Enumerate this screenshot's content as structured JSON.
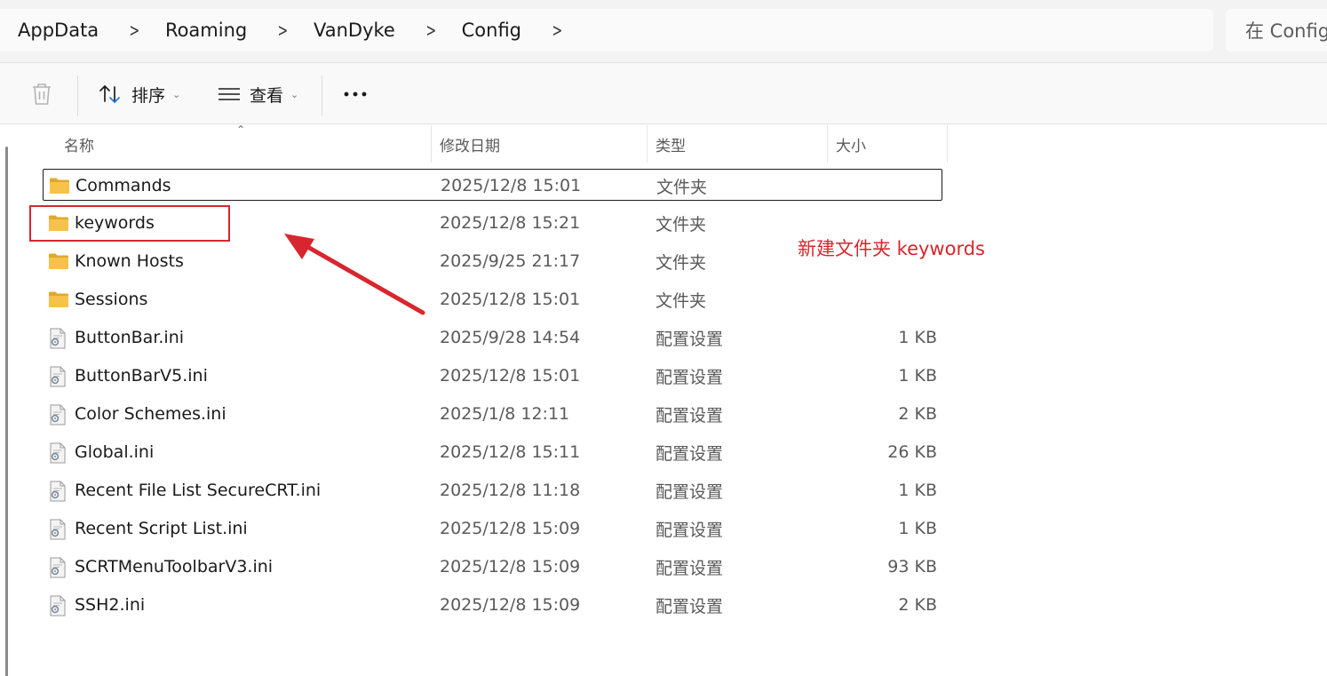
{
  "breadcrumb": [
    "AppData",
    "Roaming",
    "VanDyke",
    "Config"
  ],
  "search": {
    "placeholder": "在 Config"
  },
  "toolbar": {
    "sort_label": "排序",
    "view_label": "查看"
  },
  "columns": {
    "name": "名称",
    "modified": "修改日期",
    "type": "类型",
    "size": "大小"
  },
  "files": [
    {
      "name": "Commands",
      "modified": "2025/12/8 15:01",
      "type": "文件夹",
      "size": "",
      "icon": "folder-icon",
      "selected": true
    },
    {
      "name": "keywords",
      "modified": "2025/12/8 15:21",
      "type": "文件夹",
      "size": "",
      "icon": "folder-icon"
    },
    {
      "name": "Known Hosts",
      "modified": "2025/9/25 21:17",
      "type": "文件夹",
      "size": "",
      "icon": "folder-icon"
    },
    {
      "name": "Sessions",
      "modified": "2025/12/8 15:01",
      "type": "文件夹",
      "size": "",
      "icon": "folder-icon"
    },
    {
      "name": "ButtonBar.ini",
      "modified": "2025/9/28 14:54",
      "type": "配置设置",
      "size": "1 KB",
      "icon": "config-file-icon"
    },
    {
      "name": "ButtonBarV5.ini",
      "modified": "2025/12/8 15:01",
      "type": "配置设置",
      "size": "1 KB",
      "icon": "config-file-icon"
    },
    {
      "name": "Color Schemes.ini",
      "modified": "2025/1/8 12:11",
      "type": "配置设置",
      "size": "2 KB",
      "icon": "config-file-icon"
    },
    {
      "name": "Global.ini",
      "modified": "2025/12/8 15:11",
      "type": "配置设置",
      "size": "26 KB",
      "icon": "config-file-icon"
    },
    {
      "name": "Recent File List SecureCRT.ini",
      "modified": "2025/12/8 11:18",
      "type": "配置设置",
      "size": "1 KB",
      "icon": "config-file-icon"
    },
    {
      "name": "Recent Script List.ini",
      "modified": "2025/12/8 15:09",
      "type": "配置设置",
      "size": "1 KB",
      "icon": "config-file-icon"
    },
    {
      "name": "SCRTMenuToolbarV3.ini",
      "modified": "2025/12/8 15:09",
      "type": "配置设置",
      "size": "93 KB",
      "icon": "config-file-icon"
    },
    {
      "name": "SSH2.ini",
      "modified": "2025/12/8 15:09",
      "type": "配置设置",
      "size": "2 KB",
      "icon": "config-file-icon"
    }
  ],
  "annotation": {
    "text": "新建文件夹 keywords",
    "color": "#d8262e"
  },
  "colors": {
    "accent": "#1e78d7",
    "folder": "#f6c24a"
  }
}
